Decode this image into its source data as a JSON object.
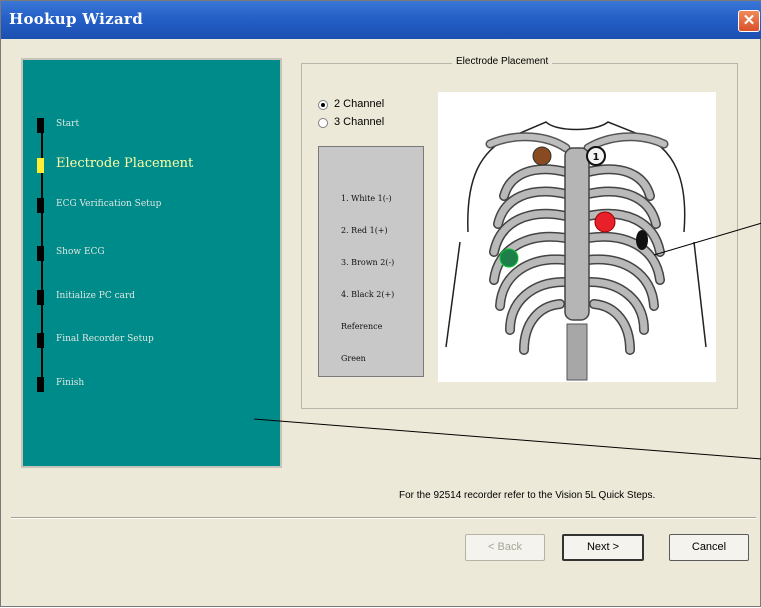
{
  "window": {
    "title": "Hookup Wizard",
    "close_label": "✕"
  },
  "steps": [
    {
      "label": "Start",
      "active": false
    },
    {
      "label": "Electrode Placement",
      "active": true
    },
    {
      "label": "ECG Verification Setup",
      "active": false
    },
    {
      "label": "Show ECG",
      "active": false
    },
    {
      "label": "Initialize PC card",
      "active": false
    },
    {
      "label": "Final Recorder Setup",
      "active": false
    },
    {
      "label": "Finish",
      "active": false
    }
  ],
  "placement": {
    "group_title": "Electrode Placement",
    "channel_options": [
      {
        "label": "2 Channel",
        "checked": true
      },
      {
        "label": "3 Channel",
        "checked": false
      }
    ],
    "legend": [
      "1. White 1(-)",
      "2. Red 1(+)",
      "3. Brown 2(-)",
      "4. Black 2(+)",
      "Reference",
      "Green"
    ],
    "electrode_number": "1",
    "electrode_colors": {
      "white": "#f4f4f4",
      "red": "#e8202a",
      "brown": "#8a4a20",
      "black": "#111111",
      "green": "#1f7f4a"
    }
  },
  "footer": {
    "note": "For the 92514 recorder refer to the Vision 5L Quick Steps."
  },
  "buttons": {
    "back": "< Back",
    "next": "Next >",
    "cancel": "Cancel"
  },
  "colors": {
    "title_bar": "#2560c8",
    "steps_panel": "#008b8b",
    "dialog_bg": "#ece9d8"
  }
}
